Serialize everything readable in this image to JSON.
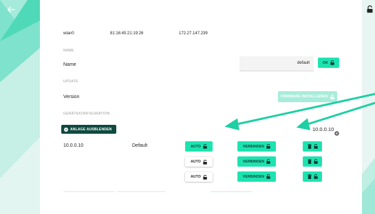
{
  "network": {
    "interface": "wlan0",
    "mac": "81:16:45:21:19:26",
    "ip": "172.27.147.239"
  },
  "name_section": {
    "header": "NAME",
    "label": "Name",
    "value": "default",
    "ok_label": "OK"
  },
  "update_section": {
    "header": "UPDATE",
    "label": "Version",
    "install_label": "FIRMWARE INSTALLIEREN"
  },
  "device_section": {
    "header": "GERÄTEKONFIGURATION",
    "hide_button_label": "ANLAGE AUSBLENDEN",
    "ip_header": "10.0.0.10",
    "rows": [
      {
        "ip": "10.0.0.10",
        "name": "Default",
        "auto_label": "AUTO",
        "auto_active": true,
        "connect_label": "VERBINDEN"
      },
      {
        "ip": "",
        "name": "",
        "auto_label": "AUTO",
        "auto_active": false,
        "connect_label": "VERBINDEN"
      },
      {
        "ip": "",
        "name": "",
        "auto_label": "AUTO",
        "auto_active": false,
        "connect_label": "VERBINDEN"
      }
    ]
  },
  "colors": {
    "accent": "#1ee3b0",
    "arrow": "#1ecfa4",
    "dark_accent": "#0f4a3f"
  },
  "icons": [
    "back-arrow-icon",
    "lock-icon",
    "trash-icon",
    "info-icon",
    "settings-icon"
  ]
}
